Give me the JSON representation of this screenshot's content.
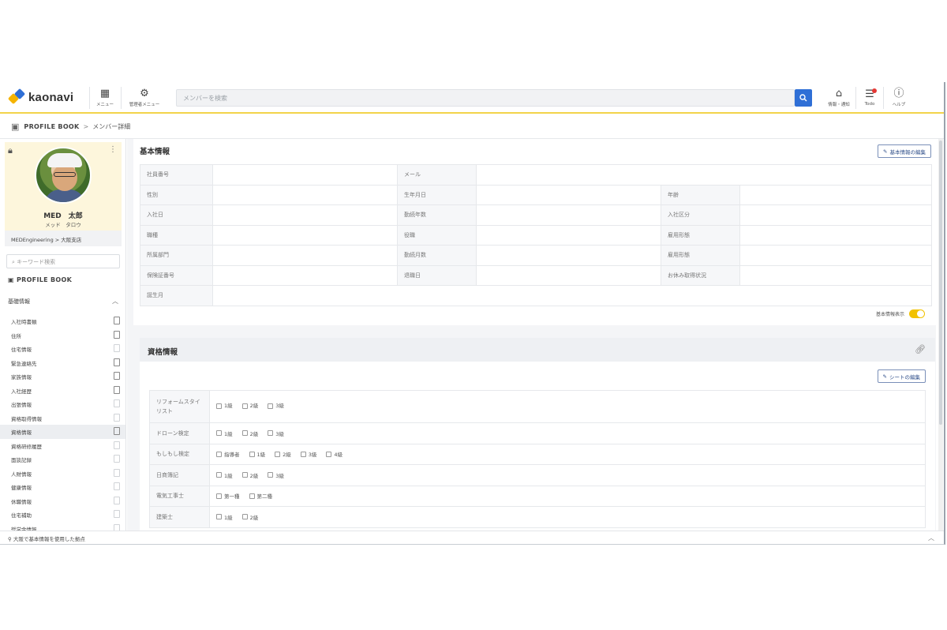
{
  "header": {
    "logo_text": "kaonavi",
    "members_label": "メニュー",
    "admin_label": "管理者メニュー",
    "search_placeholder": "メンバーを検索",
    "notify_label": "情報・通知",
    "todo_label": "Todo",
    "help_label": "ヘルプ"
  },
  "breadcrumb": {
    "root": "PROFILE BOOK",
    "separator": ">",
    "current": "メンバー詳細"
  },
  "profile": {
    "name": "MED　太郎",
    "kana": "メッド　タロウ",
    "department": "MEDEngineering > 大阪支店"
  },
  "sidebar": {
    "keyword_placeholder": "キーワード検索",
    "profile_book": "PROFILE BOOK",
    "group_label": "基礎情報",
    "items": [
      {
        "label": "入社時書類",
        "icon": "document-icon"
      },
      {
        "label": "住所",
        "icon": "document-icon"
      },
      {
        "label": "住宅情報",
        "icon": "document-icon-light"
      },
      {
        "label": "緊急連絡先",
        "icon": "document-icon"
      },
      {
        "label": "家族情報",
        "icon": "document-icon"
      },
      {
        "label": "入社経歴",
        "icon": "document-icon"
      },
      {
        "label": "出張情報",
        "icon": "document-icon-light"
      },
      {
        "label": "資格取得情報",
        "icon": "document-icon-light"
      },
      {
        "label": "資格情報",
        "icon": "document-icon",
        "active": true
      },
      {
        "label": "資格研修履歴",
        "icon": "document-icon-light"
      },
      {
        "label": "面談記録",
        "icon": "document-icon-light"
      },
      {
        "label": "人財情報",
        "icon": "document-icon-light"
      },
      {
        "label": "健康情報",
        "icon": "document-icon-light"
      },
      {
        "label": "休職情報",
        "icon": "document-icon-light"
      },
      {
        "label": "住宅補助",
        "icon": "document-icon-light"
      },
      {
        "label": "奨学金情報",
        "icon": "document-icon-light"
      }
    ]
  },
  "basic_info": {
    "title": "基本情報",
    "edit_label": "基本情報の編集",
    "rows": [
      [
        "社員番号",
        "",
        "メール",
        "",
        "",
        ""
      ],
      [
        "性別",
        "",
        "生年月日",
        "",
        "年齢",
        ""
      ],
      [
        "入社日",
        "",
        "勤続年数",
        "",
        "入社区分",
        ""
      ],
      [
        "職種",
        "",
        "役職",
        "",
        "雇用形態",
        ""
      ],
      [
        "所属部門",
        "",
        "勤続月数",
        "",
        "雇用形態",
        ""
      ],
      [
        "保険証番号",
        "",
        "退職日",
        "",
        "お休み取得状況",
        ""
      ],
      [
        "誕生月",
        "",
        "",
        "",
        "",
        ""
      ]
    ],
    "toggle_label": "基本情報表示"
  },
  "qualifications": {
    "title": "資格情報",
    "edit_label": "シートの編集",
    "rows": [
      {
        "label": "リフォームスタイリスト",
        "options": [
          "1級",
          "2級",
          "3級"
        ],
        "tall": true
      },
      {
        "label": "ドローン検定",
        "options": [
          "1級",
          "2級",
          "3級"
        ]
      },
      {
        "label": "もしもし検定",
        "options": [
          "指導者",
          "1級",
          "2級",
          "3級",
          "4級"
        ]
      },
      {
        "label": "日商簿記",
        "options": [
          "1級",
          "2級",
          "3級"
        ]
      },
      {
        "label": "電気工事士",
        "options": [
          "第一種",
          "第二種"
        ]
      },
      {
        "label": "建築士",
        "options": [
          "1級",
          "2級"
        ]
      }
    ]
  },
  "footer": {
    "status": "大阪で基本情報を使用した拠点"
  }
}
